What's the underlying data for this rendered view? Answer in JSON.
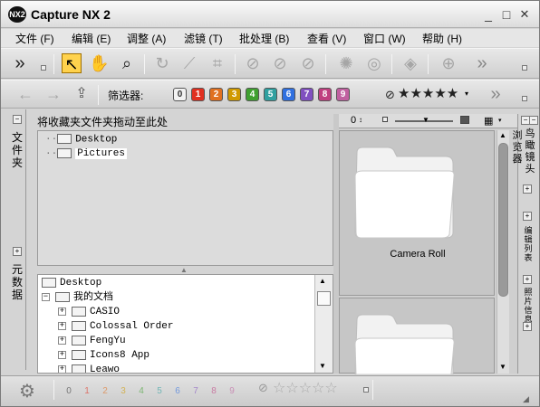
{
  "window": {
    "title": "Capture NX 2",
    "logo_text": "NX2",
    "minimize": "_",
    "maximize": "□",
    "close": "✕"
  },
  "menu": [
    "文件 (F)",
    "编辑 (E)",
    "调整 (A)",
    "滤镜 (T)",
    "批处理 (B)",
    "查看 (V)",
    "窗口 (W)",
    "帮助 (H)"
  ],
  "toolbar": {
    "more": "»",
    "filter_label": "筛选器:",
    "filter_numbers": [
      "0",
      "1",
      "2",
      "3",
      "4",
      "5",
      "6",
      "7",
      "8",
      "9"
    ],
    "filter_colors": [
      "#f2f2f2",
      "#e03020",
      "#e07020",
      "#d09a00",
      "#40a030",
      "#30a0a0",
      "#3070e0",
      "#8050c0",
      "#c04080",
      "#c060a0"
    ]
  },
  "left": {
    "tab_folder": "文件夹",
    "tab_meta": "元数据",
    "favorites_header": "将收藏夹文件夹拖动至此处",
    "favorites": [
      "Desktop",
      "Pictures"
    ],
    "tree": [
      {
        "label": "Desktop",
        "level": 0,
        "toggle": ""
      },
      {
        "label": "我的文档",
        "level": 0,
        "toggle": "−"
      },
      {
        "label": "CASIO",
        "level": 1,
        "toggle": "+"
      },
      {
        "label": "Colossal Order",
        "level": 1,
        "toggle": "+"
      },
      {
        "label": "FengYu",
        "level": 1,
        "toggle": "+"
      },
      {
        "label": "Icons8 App",
        "level": 1,
        "toggle": "+"
      },
      {
        "label": "Leawo",
        "level": 1,
        "toggle": "+"
      }
    ]
  },
  "browser": {
    "count_label": "0",
    "folders": [
      "Camera Roll",
      ""
    ]
  },
  "right_tabs": {
    "browser": "浏览器",
    "birdseye": "鸟瞰镜头",
    "edit_list": "编辑列表",
    "photo_info": "照片信息"
  },
  "status": {
    "numbers": [
      "0",
      "1",
      "2",
      "3",
      "4",
      "5",
      "6",
      "7",
      "8",
      "9"
    ]
  }
}
